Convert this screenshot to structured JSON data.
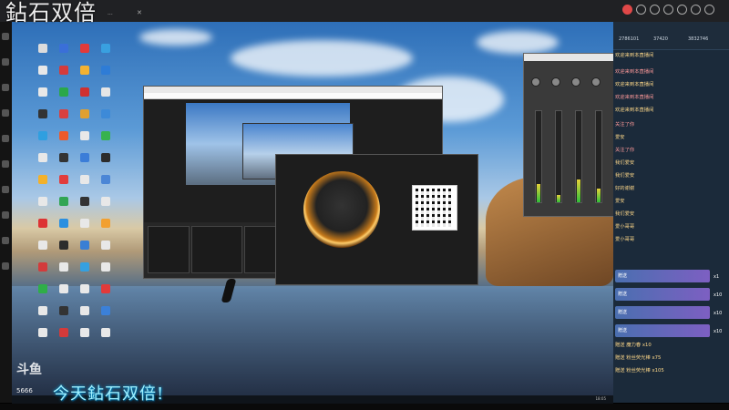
{
  "window": {
    "title": "鉆石双倍",
    "tab": "...",
    "tab_close": "✕"
  },
  "overlay_banner": "今天鉆石双倍!",
  "watermark": {
    "logo": "斗鱼",
    "room_id": "5666"
  },
  "chat": {
    "stats": [
      "2786101",
      "37420",
      "3832746"
    ],
    "messages": [
      {
        "text": "欢迎来到本直播间",
        "color": "#ffd98a"
      },
      {
        "text": "欢迎来到本直播间",
        "color": "#ff9a9a"
      },
      {
        "text": "欢迎来到本直播间",
        "color": "#ffd98a"
      },
      {
        "text": "欢迎来到本直播间",
        "color": "#ff9a9a"
      },
      {
        "text": "欢迎来到本直播间",
        "color": "#ffd98a"
      },
      {
        "text": "关注了你",
        "color": "#ff9a9a"
      },
      {
        "text": "爱安",
        "color": "#ffd98a"
      },
      {
        "text": "关注了你",
        "color": "#ff9a9a"
      },
      {
        "text": "我们爱安",
        "color": "#ffd98a"
      },
      {
        "text": "我们爱安",
        "color": "#ffd98a"
      },
      {
        "text": "好的谢谢",
        "color": "#ffd98a"
      },
      {
        "text": "爱安",
        "color": "#ffd98a"
      },
      {
        "text": "我们爱安",
        "color": "#ffd98a"
      },
      {
        "text": "爱小哥哥",
        "color": "#ffd98a"
      },
      {
        "text": "爱小哥哥",
        "color": "#ffd98a"
      }
    ],
    "gifts": [
      {
        "label": "赠送",
        "count": "x1"
      },
      {
        "label": "赠送",
        "count": "x10"
      },
      {
        "label": "赠送",
        "count": "x10"
      },
      {
        "label": "赠送",
        "count": "x10"
      }
    ],
    "bottom": [
      {
        "text": "赠送 魔力春",
        "count": "x10"
      },
      {
        "text": "赠送 粉丝荧光棒",
        "count": "x75"
      },
      {
        "text": "赠送 粉丝荧光棒",
        "count": "x105"
      }
    ]
  },
  "taskbar": {
    "time": "18:05"
  },
  "colors": {
    "accent": "#e04848",
    "banner": "#9ff0ff"
  }
}
